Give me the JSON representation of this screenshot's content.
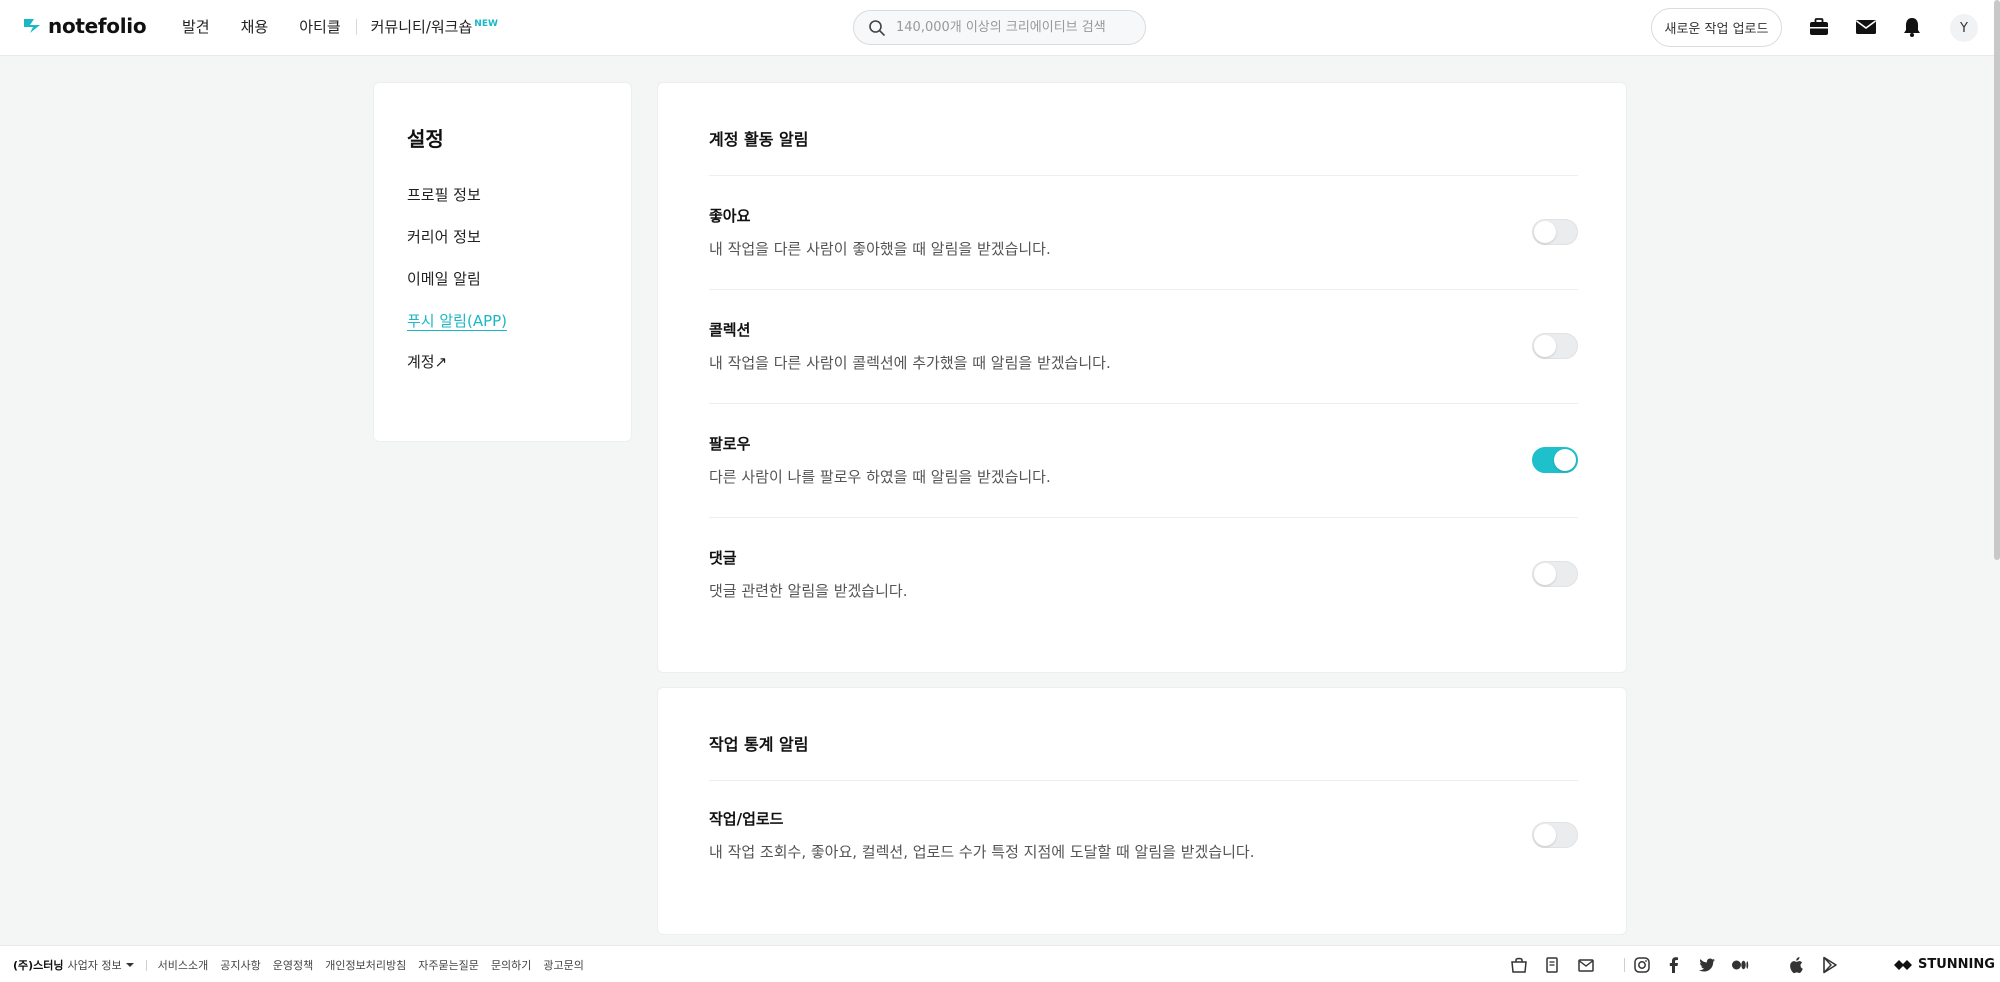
{
  "header": {
    "logo_text": "notefolio",
    "nav": [
      {
        "label": "발견"
      },
      {
        "label": "채용"
      },
      {
        "label": "아티클"
      }
    ],
    "community_label": "커뮤니티/워크숍",
    "community_badge": "NEW",
    "search_placeholder": "140,000개 이상의 크리에이티브 검색",
    "upload_label": "새로운 작업 업로드",
    "avatar_initial": "Y",
    "accent_color": "#1ab7c6"
  },
  "sidebar": {
    "title": "설정",
    "items": [
      {
        "label": "프로필 정보",
        "active": false
      },
      {
        "label": "커리어 정보",
        "active": false
      },
      {
        "label": "이메일 알림",
        "active": false
      },
      {
        "label": "푸시 알림(APP)",
        "active": true
      },
      {
        "label": "계정↗",
        "active": false
      }
    ]
  },
  "sections": [
    {
      "title": "계정 활동 알림",
      "rows": [
        {
          "title": "좋아요",
          "desc": "내 작업을 다른 사람이 좋아했을 때 알림을 받겠습니다.",
          "enabled": false
        },
        {
          "title": "콜렉션",
          "desc": "내 작업을 다른 사람이 콜렉션에 추가했을 때 알림을 받겠습니다.",
          "enabled": false
        },
        {
          "title": "팔로우",
          "desc": "다른 사람이 나를 팔로우 하였을 때 알림을 받겠습니다.",
          "enabled": true
        },
        {
          "title": "댓글",
          "desc": "댓글 관련한 알림을 받겠습니다.",
          "enabled": false
        }
      ]
    },
    {
      "title": "작업 통계 알림",
      "rows": [
        {
          "title": "작업/업로드",
          "desc": "내 작업 조회수, 좋아요, 컬렉션, 업로드 수가 특정 지점에 도달할 때 알림을 받겠습니다.",
          "enabled": false
        }
      ]
    }
  ],
  "footer": {
    "company": "(주)스터닝",
    "biz_info": "사업자 정보",
    "links": [
      "서비스소개",
      "공지사항",
      "운영정책",
      "개인정보처리방침",
      "자주묻는질문",
      "문의하기",
      "광고문의"
    ],
    "brand": "STUNNING"
  }
}
